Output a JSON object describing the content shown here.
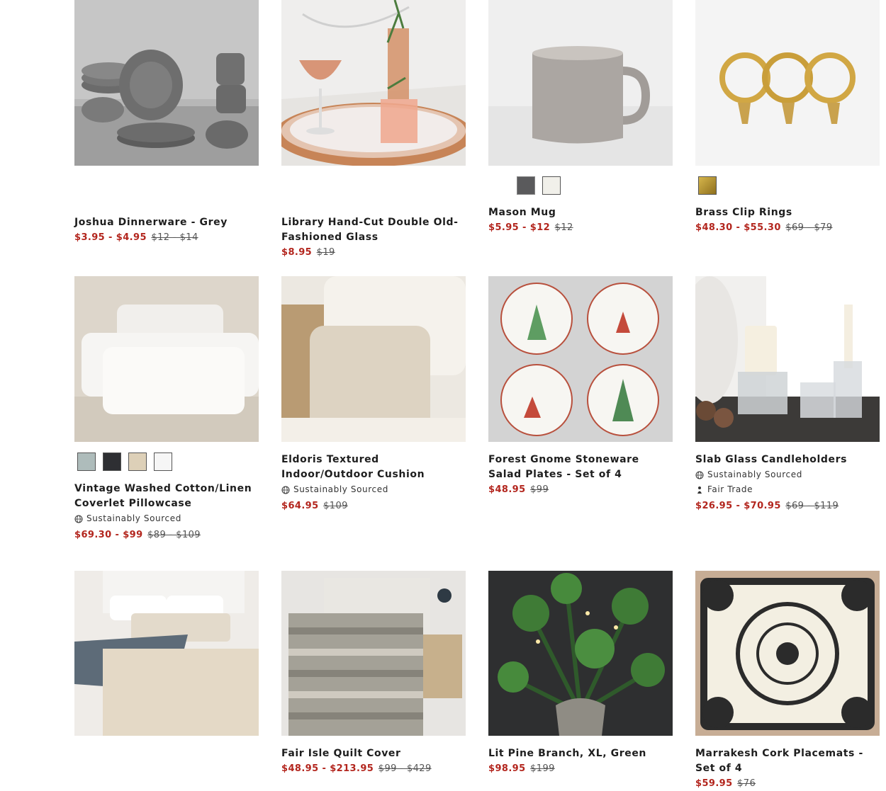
{
  "products": [
    {
      "title": "Joshua Dinnerware - Grey",
      "sale": "$3.95 - $4.95",
      "orig": "$12 - $14",
      "swatches": [],
      "badges": []
    },
    {
      "title": "Library Hand-Cut Double Old-Fashioned Glass",
      "sale": "$8.95",
      "orig": "$19",
      "swatches": [],
      "badges": []
    },
    {
      "title": "Mason Mug",
      "sale": "$5.95 - $12",
      "orig": "$12",
      "swatches": [
        "#5a5a5c",
        "#f1f0ea"
      ],
      "badges": []
    },
    {
      "title": "Brass Clip Rings",
      "sale": "$48.30 - $55.30",
      "orig": "$69 - $79",
      "swatches": [
        "#b8962f"
      ],
      "badges": []
    },
    {
      "title": "Vintage Washed Cotton/Linen Coverlet Pillowcase",
      "sale": "$69.30 - $99",
      "orig": "$89 - $109",
      "swatches": [
        "#aebcbb",
        "#2e2f33",
        "#ddd0b8",
        "#f2f2f2"
      ],
      "badges": [
        "Sustainably Sourced"
      ]
    },
    {
      "title": "Eldoris Textured Indoor/Outdoor Cushion",
      "sale": "$64.95",
      "orig": "$109",
      "swatches": [],
      "badges": [
        "Sustainably Sourced"
      ]
    },
    {
      "title": "Forest Gnome Stoneware Salad Plates - Set of 4",
      "sale": "$48.95",
      "orig": "$99",
      "swatches": [],
      "badges": []
    },
    {
      "title": "Slab Glass Candleholders",
      "sale": "$26.95 - $70.95",
      "orig": "$69 - $119",
      "swatches": [],
      "badges": [
        "Sustainably Sourced",
        "Fair Trade"
      ]
    },
    {
      "title": "",
      "sale": "",
      "orig": "",
      "swatches": [],
      "badges": []
    },
    {
      "title": "Fair Isle Quilt Cover",
      "sale": "$48.95 - $213.95",
      "orig": "$99 - $429",
      "swatches": [],
      "badges": []
    },
    {
      "title": "Lit Pine Branch, XL, Green",
      "sale": "$98.95",
      "orig": "$199",
      "swatches": [],
      "badges": []
    },
    {
      "title": "Marrakesh Cork Placemats - Set of 4",
      "sale": "$59.95",
      "orig": "$76",
      "swatches": [],
      "badges": []
    }
  ],
  "colors": {
    "sale": "#b3261e",
    "title": "#1e1e1e"
  }
}
